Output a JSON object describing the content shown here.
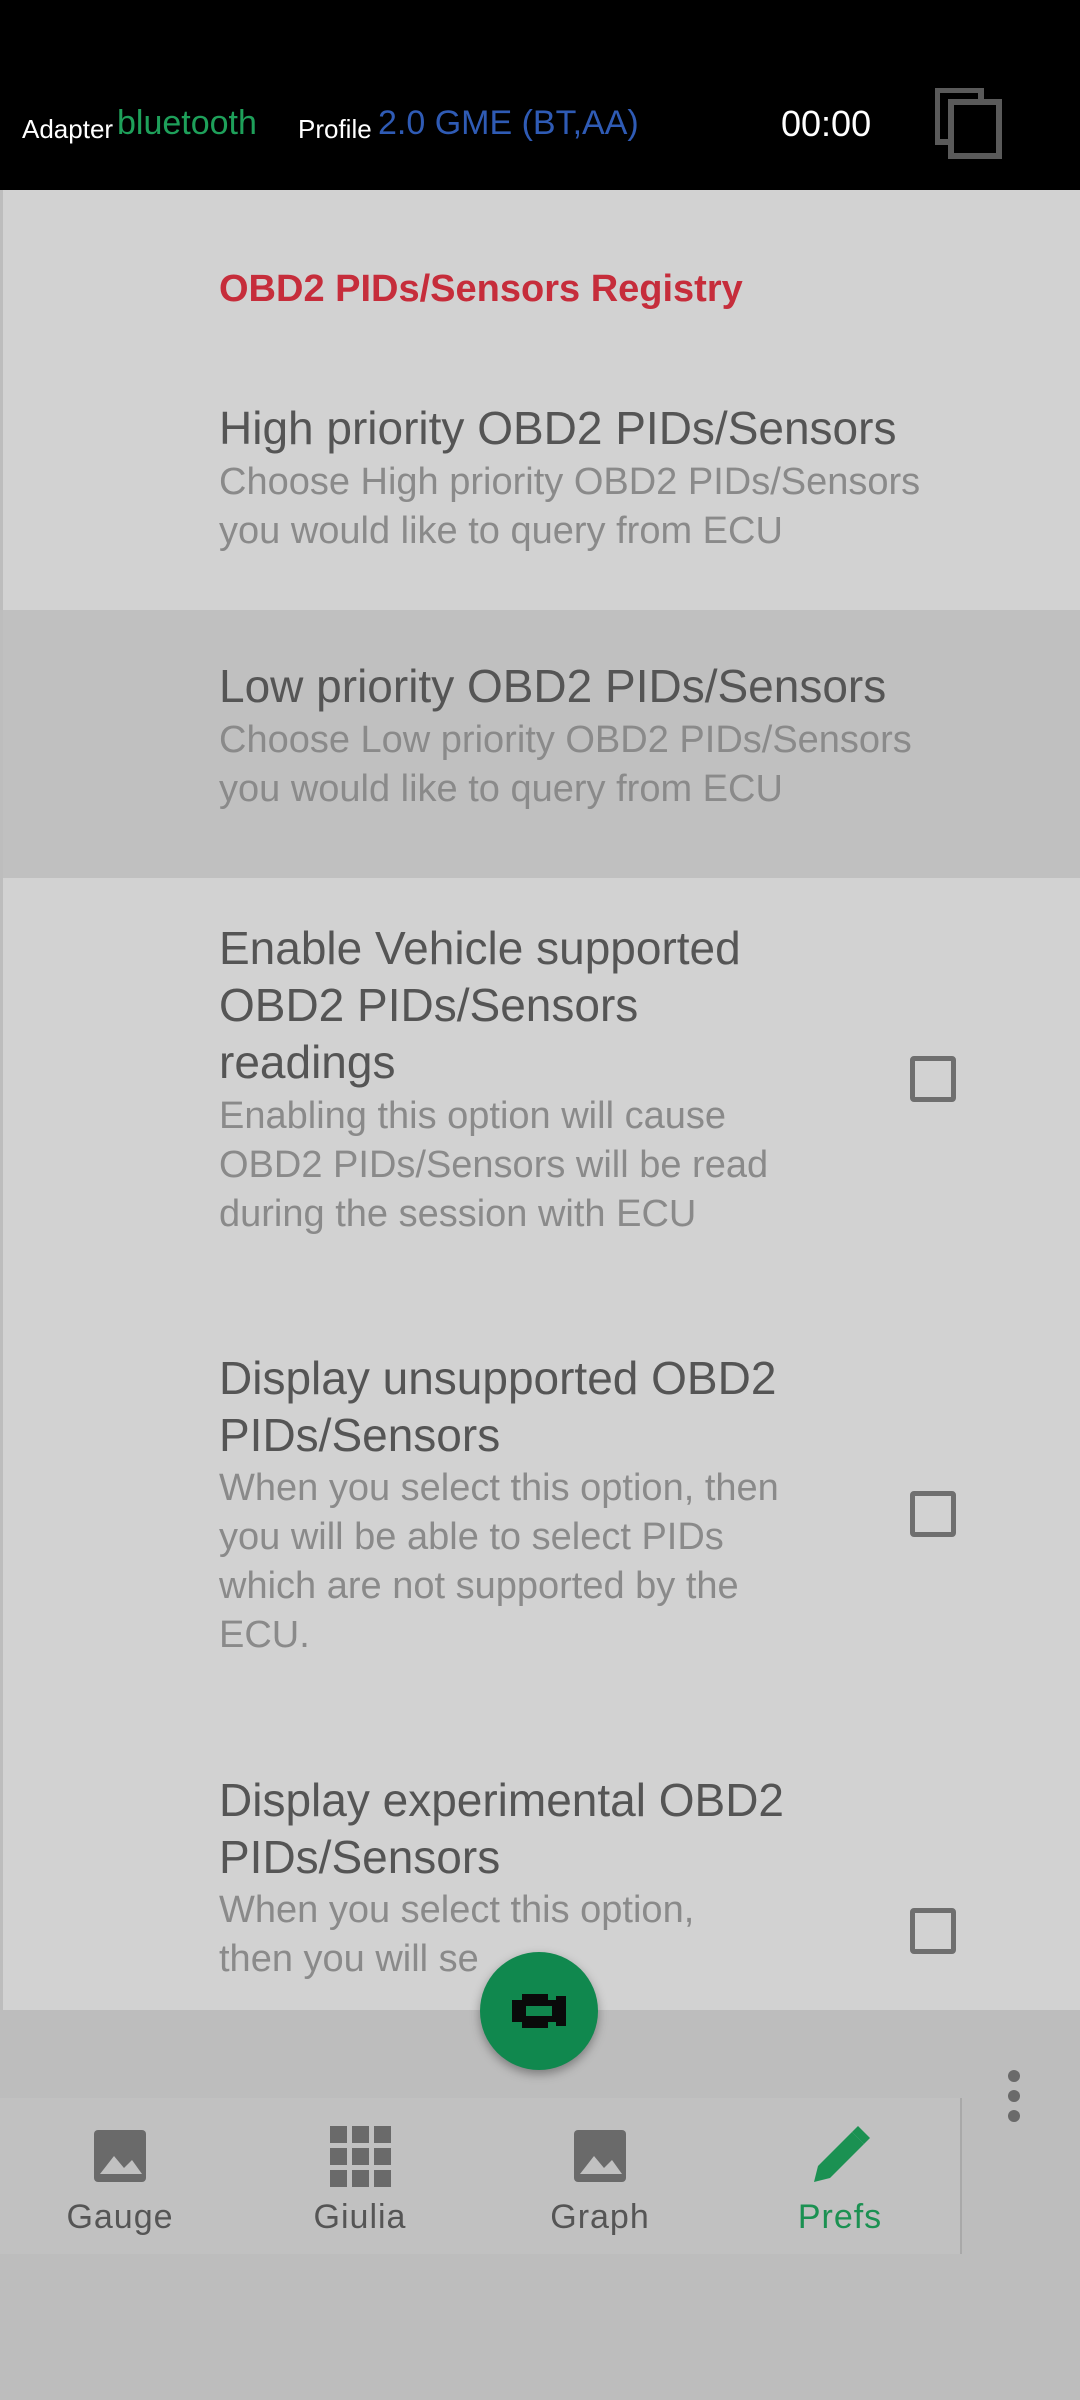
{
  "header": {
    "adapter_label": "Adapter",
    "adapter_value": "bluetooth",
    "profile_label": "Profile",
    "profile_value": "2.0 GME (BT,AA)",
    "timer": "00:00",
    "copy_icon": "copy-icon",
    "colors": {
      "adapter": "#1ea05a",
      "profile": "#2f5bb5"
    }
  },
  "settings": {
    "category": "OBD2 PIDs/Sensors Registry",
    "items": [
      {
        "title": "High priority OBD2 PIDs/Sensors",
        "summary_lines": [
          "Choose High priority OBD2 PIDs/Sensors",
          "you would like to query from ECU"
        ]
      },
      {
        "title": "Low priority OBD2 PIDs/Sensors",
        "summary_lines": [
          "Choose Low priority OBD2 PIDs/Sensors",
          "you would like to query from ECU"
        ]
      },
      {
        "title_lines": [
          "Enable Vehicle supported",
          "OBD2 PIDs/Sensors",
          "readings"
        ],
        "summary_lines": [
          "Enabling this option will cause",
          "OBD2 PIDs/Sensors will be read",
          "during the session with ECU"
        ],
        "checked": false
      },
      {
        "title_lines": [
          "Display unsupported OBD2",
          "PIDs/Sensors"
        ],
        "summary_lines": [
          "When you select this option, then",
          "you will be able to select PIDs",
          "which are not supported by the",
          "ECU."
        ],
        "checked": false
      },
      {
        "title_lines": [
          "Display experimental OBD2",
          "PIDs/Sensors"
        ],
        "summary_lines": [
          "When you select this option,",
          "then you will se"
        ],
        "checked": false
      }
    ]
  },
  "fab": {
    "icon": "engine-icon"
  },
  "nav": {
    "items": [
      {
        "label": "Gauge",
        "icon": "image-icon"
      },
      {
        "label": "Giulia",
        "icon": "grid-icon"
      },
      {
        "label": "Graph",
        "icon": "image-icon"
      },
      {
        "label": "Prefs",
        "icon": "pencil-icon",
        "active": true
      }
    ],
    "active_color": "#1b9152"
  },
  "overflow_menu_icon": "more-vert-icon"
}
